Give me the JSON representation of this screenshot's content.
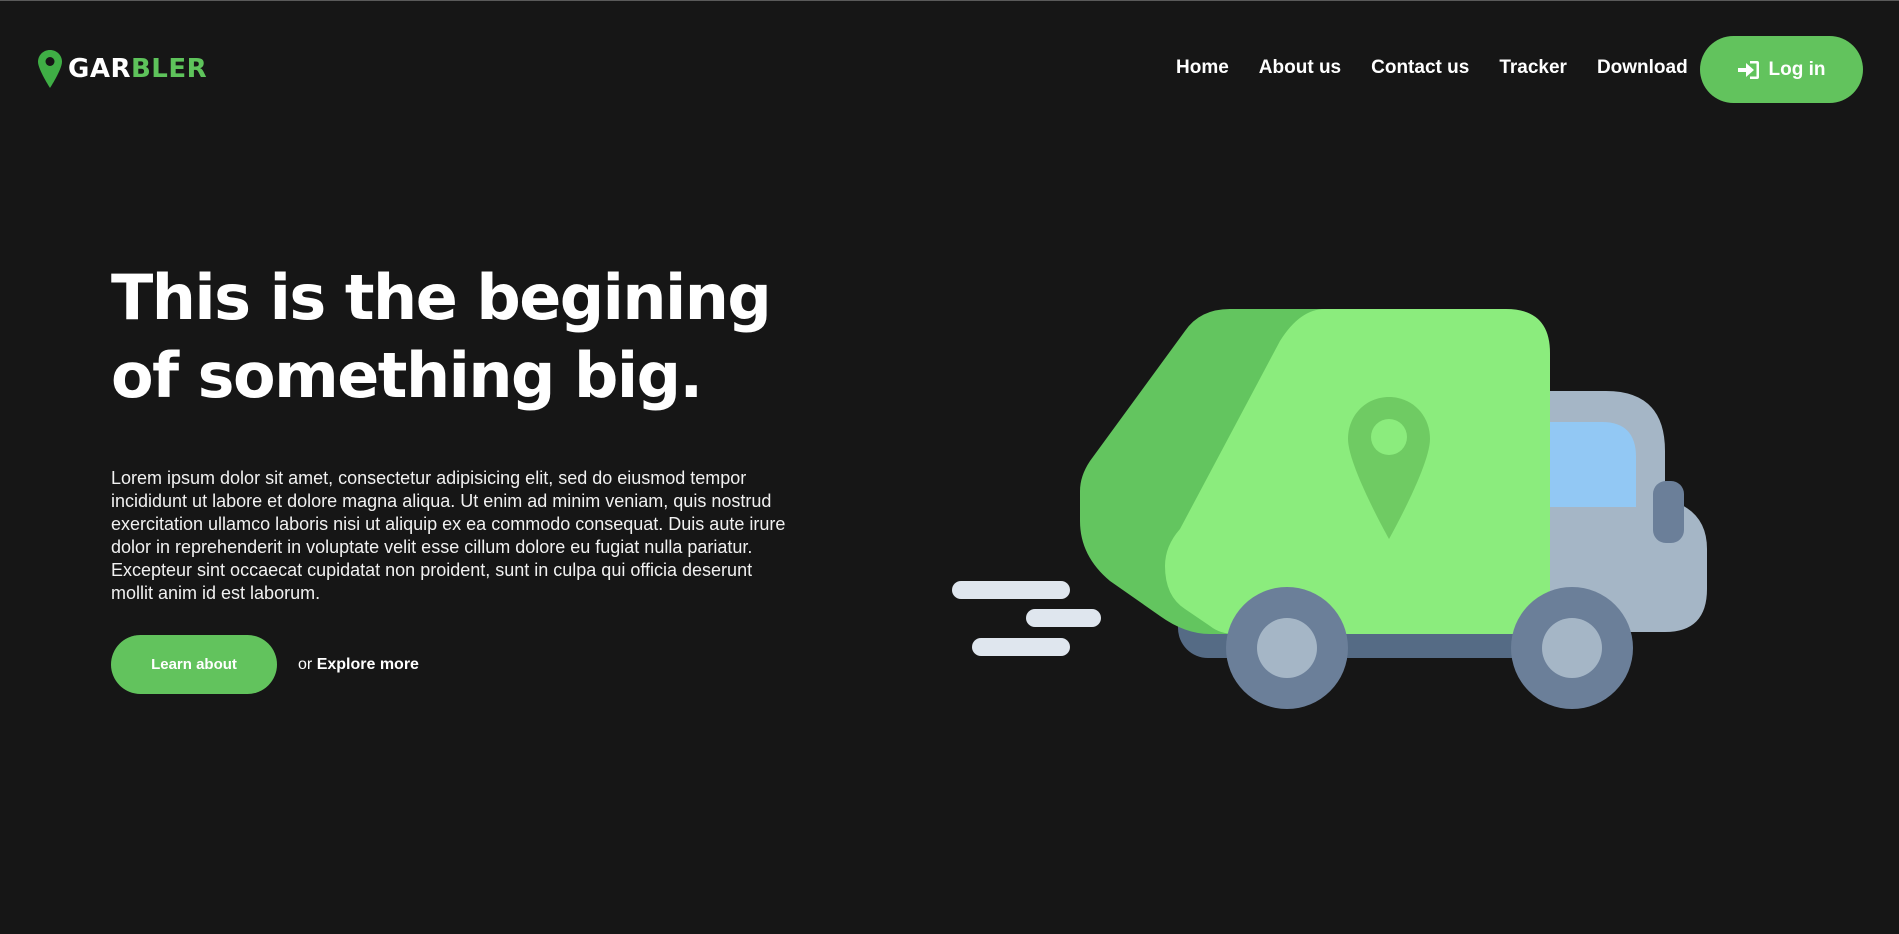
{
  "brand": {
    "part1": "GAR",
    "part2": "BLER",
    "accent_color": "#5ec35b"
  },
  "nav": {
    "items": [
      {
        "label": "Home"
      },
      {
        "label": "About us"
      },
      {
        "label": "Contact us"
      },
      {
        "label": "Tracker"
      },
      {
        "label": "Download"
      }
    ],
    "login_label": "Log in",
    "login_icon": "sign-in-icon"
  },
  "hero": {
    "title_line1": "This is the begining",
    "title_line2": "of something big.",
    "body": "Lorem ipsum dolor sit amet, consectetur adipisicing elit, sed do eiusmod tempor incididunt ut labore et dolore magna aliqua. Ut enim ad minim veniam, quis nostrud exercitation ullamco laboris nisi ut aliquip ex ea commodo consequat. Duis aute irure dolor in reprehenderit in voluptate velit esse cillum dolore eu fugiat nulla pariatur. Excepteur sint occaecat cupidatat non proident, sunt in culpa qui officia deserunt mollit anim id est laborum.",
    "primary_button": "Learn about",
    "secondary_prefix": "or",
    "secondary_link": "Explore more"
  },
  "illustration": {
    "name": "garbage-truck-illustration",
    "colors": {
      "body_dark": "#63c55f",
      "body_light": "#8bec7d",
      "cab": "#a5b6c6",
      "window": "#92c8f4",
      "wheel": "#6b7f99",
      "hub": "#a5b6c6",
      "chassis": "#556b85",
      "speed_lines": "#dfe6ee"
    }
  }
}
